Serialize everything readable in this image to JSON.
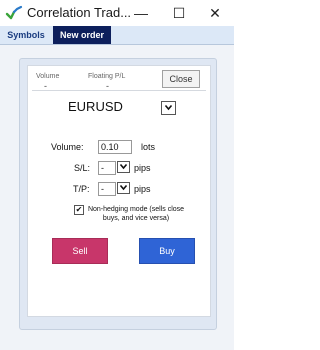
{
  "window": {
    "title": "Correlation Trad...",
    "minimize": "—",
    "maximize": "☐",
    "close": "✕",
    "icon": "check-chart-icon"
  },
  "tabs": [
    {
      "label": "Symbols"
    },
    {
      "label": "New order"
    }
  ],
  "stats": {
    "volume_label": "Volume",
    "volume_value": "-",
    "floating_label": "Floating P/L",
    "floating_value": "-",
    "close_button": "Close"
  },
  "order": {
    "symbol": "EURUSD",
    "volume_label": "Volume:",
    "volume_value": "0.10",
    "volume_unit": "lots",
    "sl_label": "S/L:",
    "sl_value": "-",
    "sl_unit": "pips",
    "tp_label": "T/P:",
    "tp_value": "-",
    "tp_unit": "pips",
    "non_hedging_checked": true,
    "non_hedging_text": "Non-hedging mode (sells close buys, and vice versa)",
    "sell_label": "Sell",
    "buy_label": "Buy"
  },
  "colors": {
    "sell": "#c8366a",
    "buy": "#2f64d6",
    "tab_active": "#0d1f5c"
  }
}
